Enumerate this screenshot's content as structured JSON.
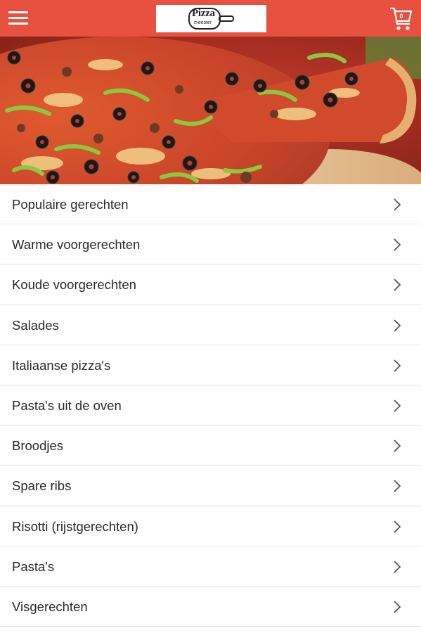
{
  "header": {
    "brand_color": "#e8503f",
    "menu_icon": "hamburger-icon",
    "logo_word": "Pizza",
    "logo_subtext": "meester",
    "cart_icon": "shopping-cart-icon",
    "cart_count": "0"
  },
  "hero": {
    "image": "pizza-photo"
  },
  "categories": [
    {
      "label": "Populaire gerechten"
    },
    {
      "label": "Warme voorgerechten"
    },
    {
      "label": "Koude voorgerechten"
    },
    {
      "label": "Salades"
    },
    {
      "label": "Italiaanse pizza's"
    },
    {
      "label": "Pasta's uit de oven"
    },
    {
      "label": "Broodjes"
    },
    {
      "label": "Spare ribs"
    },
    {
      "label": "Risotti (rijstgerechten)"
    },
    {
      "label": "Pasta's"
    },
    {
      "label": "Visgerechten"
    }
  ],
  "item_icon": "chevron-right-icon"
}
